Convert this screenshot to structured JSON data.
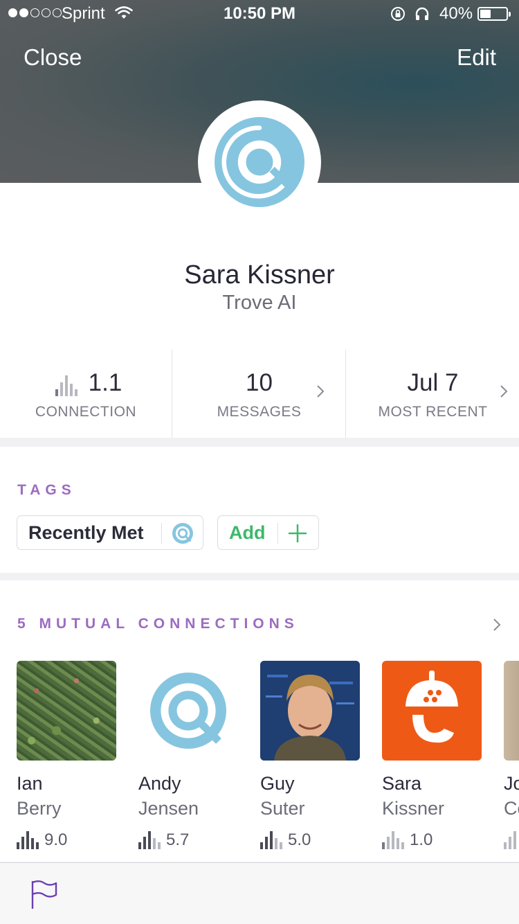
{
  "status_bar": {
    "carrier": "Sprint",
    "time": "10:50 PM",
    "battery_percent": "40%",
    "battery_level": 0.4,
    "signal_bars_filled": 2,
    "signal_bars_total": 5
  },
  "nav": {
    "close_label": "Close",
    "edit_label": "Edit"
  },
  "profile": {
    "name": "Sara Kissner",
    "company": "Trove AI",
    "avatar_icon": "trove-logo-icon"
  },
  "stats": {
    "connection": {
      "value": "1.1",
      "label": "CONNECTION"
    },
    "messages": {
      "value": "10",
      "label": "MESSAGES"
    },
    "most_recent": {
      "value": "Jul 7",
      "label": "MOST RECENT"
    }
  },
  "tags": {
    "title": "TAGS",
    "items": [
      {
        "label": "Recently Met",
        "icon": "trove-logo-icon"
      }
    ],
    "add_label": "Add"
  },
  "mutual": {
    "title": "5 MUTUAL CONNECTIONS",
    "people": [
      {
        "first": "Ian",
        "last": "Berry",
        "score": "9.0",
        "photo": "plants-photo"
      },
      {
        "first": "Andy",
        "last": "Jensen",
        "score": "5.7",
        "photo": "trove-logo-icon"
      },
      {
        "first": "Guy",
        "last": "Suter",
        "score": "5.0",
        "photo": "person-photo"
      },
      {
        "first": "Sara",
        "last": "Kissner",
        "score": "1.0",
        "photo": "acorn-logo-icon"
      },
      {
        "first": "Jo",
        "last": "Co",
        "score": "",
        "photo": "person-photo"
      }
    ]
  },
  "colors": {
    "accent_purple": "#9b6cc2",
    "add_green": "#3cb86a",
    "trove_blue": "#86c5df",
    "acorn_orange": "#ee5a16"
  },
  "tab_bar": {
    "icon": "flag-icon"
  }
}
